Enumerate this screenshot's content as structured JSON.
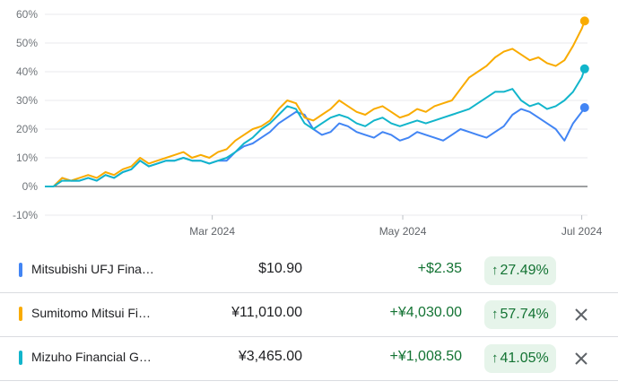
{
  "chart_data": {
    "type": "line",
    "y_ticks": [
      "60%",
      "50%",
      "40%",
      "30%",
      "20%",
      "10%",
      "0%",
      "-10%"
    ],
    "x_ticks": [
      "Mar 2024",
      "May 2024",
      "Jul 2024"
    ],
    "ylim": [
      -10,
      60
    ],
    "x_range_days": [
      0,
      188
    ],
    "x_tick_days": [
      58,
      124,
      186
    ],
    "series": [
      {
        "name": "Mitsubishi UFJ Fina…",
        "color": "#4285f4",
        "points": [
          [
            0,
            0
          ],
          [
            3,
            0
          ],
          [
            6,
            3
          ],
          [
            9,
            2
          ],
          [
            12,
            2
          ],
          [
            15,
            3
          ],
          [
            18,
            2
          ],
          [
            21,
            4
          ],
          [
            24,
            3
          ],
          [
            27,
            5
          ],
          [
            30,
            6
          ],
          [
            33,
            9
          ],
          [
            36,
            7
          ],
          [
            39,
            8
          ],
          [
            42,
            9
          ],
          [
            45,
            9
          ],
          [
            48,
            10
          ],
          [
            51,
            9
          ],
          [
            54,
            9
          ],
          [
            57,
            8
          ],
          [
            60,
            9
          ],
          [
            63,
            9
          ],
          [
            66,
            12
          ],
          [
            69,
            14
          ],
          [
            72,
            15
          ],
          [
            75,
            17
          ],
          [
            78,
            19
          ],
          [
            81,
            22
          ],
          [
            84,
            24
          ],
          [
            87,
            26
          ],
          [
            90,
            25
          ],
          [
            93,
            20
          ],
          [
            96,
            18
          ],
          [
            99,
            19
          ],
          [
            102,
            22
          ],
          [
            105,
            21
          ],
          [
            108,
            19
          ],
          [
            111,
            18
          ],
          [
            114,
            17
          ],
          [
            117,
            19
          ],
          [
            120,
            18
          ],
          [
            123,
            16
          ],
          [
            126,
            17
          ],
          [
            129,
            19
          ],
          [
            132,
            18
          ],
          [
            135,
            17
          ],
          [
            138,
            16
          ],
          [
            141,
            18
          ],
          [
            144,
            20
          ],
          [
            147,
            19
          ],
          [
            150,
            18
          ],
          [
            153,
            17
          ],
          [
            156,
            19
          ],
          [
            159,
            21
          ],
          [
            162,
            25
          ],
          [
            165,
            27
          ],
          [
            168,
            26
          ],
          [
            171,
            24
          ],
          [
            174,
            22
          ],
          [
            177,
            20
          ],
          [
            180,
            16
          ],
          [
            183,
            22
          ],
          [
            186,
            26
          ],
          [
            187,
            27.5
          ]
        ]
      },
      {
        "name": "Sumitomo Mitsui Fi…",
        "color": "#f9ab00",
        "points": [
          [
            0,
            0
          ],
          [
            3,
            0
          ],
          [
            6,
            3
          ],
          [
            9,
            2
          ],
          [
            12,
            3
          ],
          [
            15,
            4
          ],
          [
            18,
            3
          ],
          [
            21,
            5
          ],
          [
            24,
            4
          ],
          [
            27,
            6
          ],
          [
            30,
            7
          ],
          [
            33,
            10
          ],
          [
            36,
            8
          ],
          [
            39,
            9
          ],
          [
            42,
            10
          ],
          [
            45,
            11
          ],
          [
            48,
            12
          ],
          [
            51,
            10
          ],
          [
            54,
            11
          ],
          [
            57,
            10
          ],
          [
            60,
            12
          ],
          [
            63,
            13
          ],
          [
            66,
            16
          ],
          [
            69,
            18
          ],
          [
            72,
            20
          ],
          [
            75,
            21
          ],
          [
            78,
            23
          ],
          [
            81,
            27
          ],
          [
            84,
            30
          ],
          [
            87,
            29
          ],
          [
            90,
            24
          ],
          [
            93,
            23
          ],
          [
            96,
            25
          ],
          [
            99,
            27
          ],
          [
            102,
            30
          ],
          [
            105,
            28
          ],
          [
            108,
            26
          ],
          [
            111,
            25
          ],
          [
            114,
            27
          ],
          [
            117,
            28
          ],
          [
            120,
            26
          ],
          [
            123,
            24
          ],
          [
            126,
            25
          ],
          [
            129,
            27
          ],
          [
            132,
            26
          ],
          [
            135,
            28
          ],
          [
            138,
            29
          ],
          [
            141,
            30
          ],
          [
            144,
            34
          ],
          [
            147,
            38
          ],
          [
            150,
            40
          ],
          [
            153,
            42
          ],
          [
            156,
            45
          ],
          [
            159,
            47
          ],
          [
            162,
            48
          ],
          [
            165,
            46
          ],
          [
            168,
            44
          ],
          [
            171,
            45
          ],
          [
            174,
            43
          ],
          [
            177,
            42
          ],
          [
            180,
            44
          ],
          [
            183,
            49
          ],
          [
            186,
            55
          ],
          [
            187,
            57.7
          ]
        ]
      },
      {
        "name": "Mizuho Financial G…",
        "color": "#12b5cb",
        "points": [
          [
            0,
            0
          ],
          [
            3,
            0
          ],
          [
            6,
            2
          ],
          [
            9,
            2
          ],
          [
            12,
            2
          ],
          [
            15,
            3
          ],
          [
            18,
            2
          ],
          [
            21,
            4
          ],
          [
            24,
            3
          ],
          [
            27,
            5
          ],
          [
            30,
            6
          ],
          [
            33,
            9
          ],
          [
            36,
            7
          ],
          [
            39,
            8
          ],
          [
            42,
            9
          ],
          [
            45,
            9
          ],
          [
            48,
            10
          ],
          [
            51,
            9
          ],
          [
            54,
            9
          ],
          [
            57,
            8
          ],
          [
            60,
            9
          ],
          [
            63,
            10
          ],
          [
            66,
            12
          ],
          [
            69,
            15
          ],
          [
            72,
            17
          ],
          [
            75,
            20
          ],
          [
            78,
            22
          ],
          [
            81,
            25
          ],
          [
            84,
            28
          ],
          [
            87,
            27
          ],
          [
            90,
            22
          ],
          [
            93,
            20
          ],
          [
            96,
            22
          ],
          [
            99,
            24
          ],
          [
            102,
            25
          ],
          [
            105,
            24
          ],
          [
            108,
            22
          ],
          [
            111,
            21
          ],
          [
            114,
            23
          ],
          [
            117,
            24
          ],
          [
            120,
            22
          ],
          [
            123,
            21
          ],
          [
            126,
            22
          ],
          [
            129,
            23
          ],
          [
            132,
            22
          ],
          [
            135,
            23
          ],
          [
            138,
            24
          ],
          [
            141,
            25
          ],
          [
            144,
            26
          ],
          [
            147,
            27
          ],
          [
            150,
            29
          ],
          [
            153,
            31
          ],
          [
            156,
            33
          ],
          [
            159,
            33
          ],
          [
            162,
            34
          ],
          [
            165,
            30
          ],
          [
            168,
            28
          ],
          [
            171,
            29
          ],
          [
            174,
            27
          ],
          [
            177,
            28
          ],
          [
            180,
            30
          ],
          [
            183,
            33
          ],
          [
            186,
            38
          ],
          [
            187,
            41
          ]
        ]
      }
    ]
  },
  "rows": [
    {
      "name": "Mitsubishi UFJ Fina…",
      "price": "$10.90",
      "change": "+$2.35",
      "pct": "27.49%",
      "color": "#4285f4",
      "removable": false
    },
    {
      "name": "Sumitomo Mitsui Fi…",
      "price": "¥11,010.00",
      "change": "+¥4,030.00",
      "pct": "57.74%",
      "color": "#f9ab00",
      "removable": true
    },
    {
      "name": "Mizuho Financial G…",
      "price": "¥3,465.00",
      "change": "+¥1,008.50",
      "pct": "41.05%",
      "color": "#12b5cb",
      "removable": true
    }
  ],
  "icons": {
    "trend": "arrow-up-icon",
    "remove": "close-icon"
  }
}
